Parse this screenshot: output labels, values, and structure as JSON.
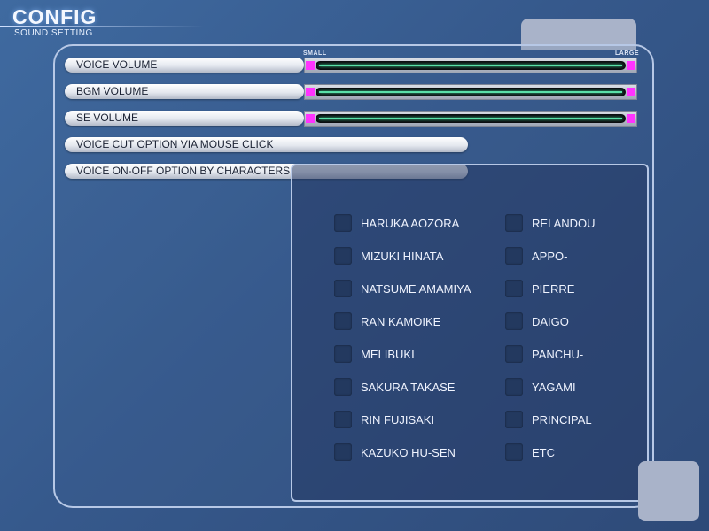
{
  "header": {
    "title": "CONFIG",
    "subtitle": "SOUND SETTING"
  },
  "sliders": {
    "scale_small": "SMALL",
    "scale_large": "LARGE",
    "voice_volume": "VOICE VOLUME",
    "bgm_volume": "BGM VOLUME",
    "se_volume": "SE VOLUME"
  },
  "options": {
    "voice_cut": "VOICE CUT OPTION VIA MOUSE CLICK",
    "voice_onoff": "VOICE ON-OFF OPTION BY CHARACTERS"
  },
  "characters": {
    "left": [
      "HARUKA AOZORA",
      "MIZUKI HINATA",
      "NATSUME AMAMIYA",
      "RAN KAMOIKE",
      "MEI IBUKI",
      "SAKURA TAKASE",
      "RIN FUJISAKI",
      "KAZUKO HU-SEN"
    ],
    "right": [
      "REI ANDOU",
      "APPO-",
      "PIERRE",
      "DAIGO",
      "PANCHU-",
      "YAGAMI",
      "PRINCIPAL",
      "ETC"
    ]
  }
}
